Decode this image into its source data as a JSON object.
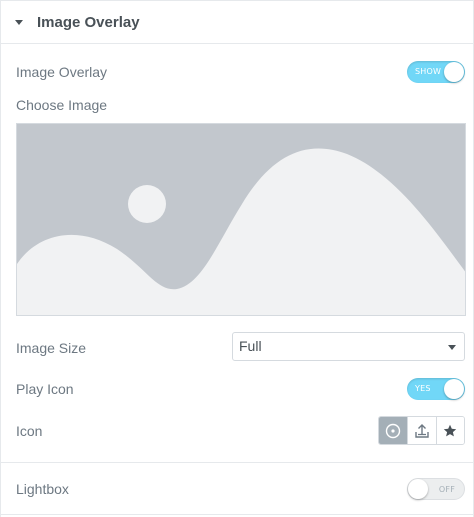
{
  "section": {
    "title": "Image Overlay"
  },
  "controls": {
    "image_overlay": {
      "label": "Image Overlay",
      "toggle_text": "SHOW",
      "state": "on"
    },
    "choose_image": {
      "label": "Choose Image"
    },
    "image_size": {
      "label": "Image Size",
      "value": "Full"
    },
    "play_icon": {
      "label": "Play Icon",
      "toggle_text": "YES",
      "state": "on"
    },
    "icon": {
      "label": "Icon",
      "options": [
        "play-circle-icon",
        "upload-icon",
        "star-icon"
      ],
      "selected": "play-circle-icon"
    },
    "lightbox": {
      "label": "Lightbox",
      "toggle_text": "OFF",
      "state": "off"
    }
  },
  "colors": {
    "toggle_on": "#71d7f7",
    "toggle_off": "#eceeef",
    "placeholder_bg": "#c2c7cd",
    "placeholder_fg": "#f1f2f3",
    "icon_active": "#a4afb7"
  }
}
